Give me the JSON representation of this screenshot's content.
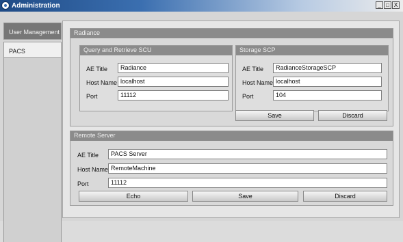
{
  "window": {
    "title": "Administration",
    "minimize": "_",
    "maximize": "□",
    "close": "X"
  },
  "sidebar": {
    "items": [
      {
        "label": "User Management"
      },
      {
        "label": "PACS"
      }
    ]
  },
  "radiance": {
    "title": "Radiance",
    "query": {
      "title": "Query and Retrieve SCU",
      "ae_label": "AE Title",
      "ae_value": "Radiance",
      "host_label": "Host Name",
      "host_value": "localhost",
      "port_label": "Port",
      "port_value": "11112"
    },
    "storage": {
      "title": "Storage SCP",
      "ae_label": "AE Title",
      "ae_value": "RadianceStorageSCP",
      "host_label": "Host Name",
      "host_value": "localhost",
      "port_label": "Port",
      "port_value": "104"
    },
    "save_label": "Save",
    "discard_label": "Discard"
  },
  "remote": {
    "title": "Remote Server",
    "ae_label": "AE Title",
    "ae_value": "PACS Server",
    "host_label": "Host Name",
    "host_value": "RemoteMachine",
    "port_label": "Port",
    "port_value": "11112",
    "echo_label": "Echo",
    "save_label": "Save",
    "discard_label": "Discard"
  }
}
